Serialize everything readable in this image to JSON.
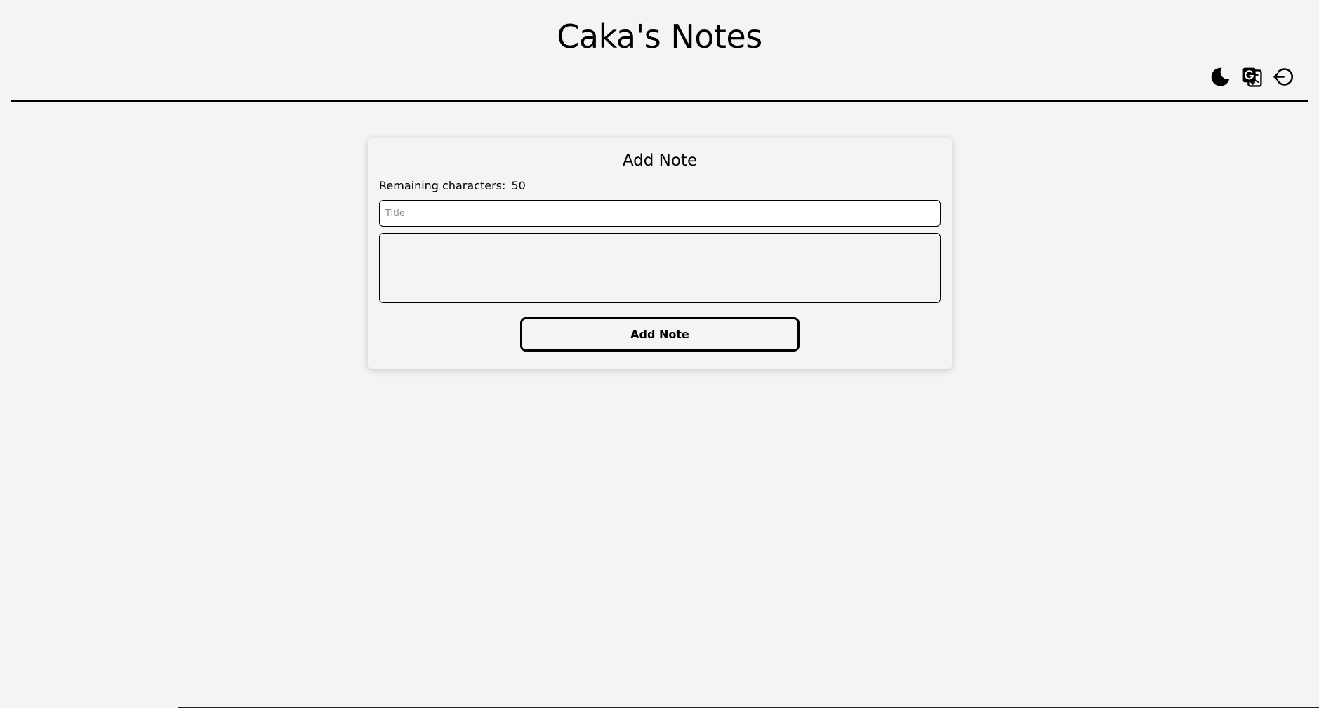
{
  "header": {
    "title": "Caka's Notes",
    "actions": [
      {
        "name": "dark-mode",
        "icon": "moon-icon"
      },
      {
        "name": "translate",
        "icon": "translate-icon"
      },
      {
        "name": "logout",
        "icon": "logout-icon"
      }
    ]
  },
  "note_form": {
    "heading": "Add Note",
    "remaining_label": "Remaining characters:",
    "remaining_count": "50",
    "title_input": {
      "placeholder": "Title",
      "value": ""
    },
    "body_input": {
      "placeholder": "",
      "value": ""
    },
    "submit_label": "Add Note"
  },
  "colors": {
    "background": "#f4f4f4",
    "foreground": "#000000"
  }
}
